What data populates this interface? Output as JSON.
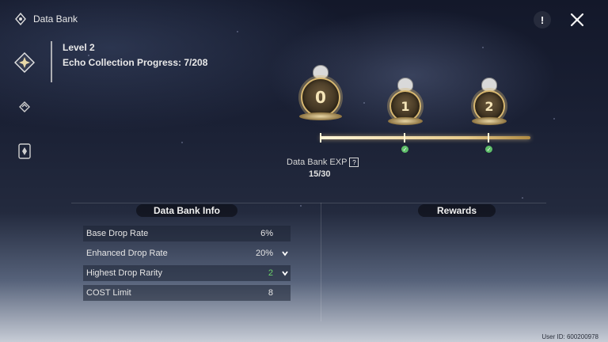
{
  "app": {
    "title": "Data Bank"
  },
  "header": {
    "help_glyph": "!",
    "icons": [
      "help-icon",
      "close-icon"
    ]
  },
  "sidebar": {
    "items": [
      {
        "name": "data-bank-tab",
        "icon": "diamond-star-icon",
        "active": true
      },
      {
        "name": "echo-tab",
        "icon": "layers-icon",
        "active": false
      },
      {
        "name": "card-tab",
        "icon": "card-icon",
        "active": false
      }
    ]
  },
  "level": {
    "title": "Level 2",
    "progress": "Echo Collection Progress: 7/208"
  },
  "milestones": [
    {
      "label": "0",
      "claimed": false
    },
    {
      "label": "1",
      "claimed": true
    },
    {
      "label": "2",
      "claimed": true
    }
  ],
  "exp": {
    "label": "Data Bank EXP",
    "help_glyph": "?",
    "value": "15/30"
  },
  "panels": {
    "info_title": "Data Bank Info",
    "rewards_title": "Rewards"
  },
  "info_rows": [
    {
      "label": "Base Drop Rate",
      "value": "6%"
    },
    {
      "label": "Enhanced Drop Rate",
      "value": "20%",
      "expandable": true
    },
    {
      "label": "Highest Drop Rarity",
      "value": "2",
      "expandable": true,
      "value_color": "#6cd36a"
    },
    {
      "label": "COST Limit",
      "value": "8"
    }
  ],
  "footer": {
    "user_id": "User ID: 600200978"
  }
}
